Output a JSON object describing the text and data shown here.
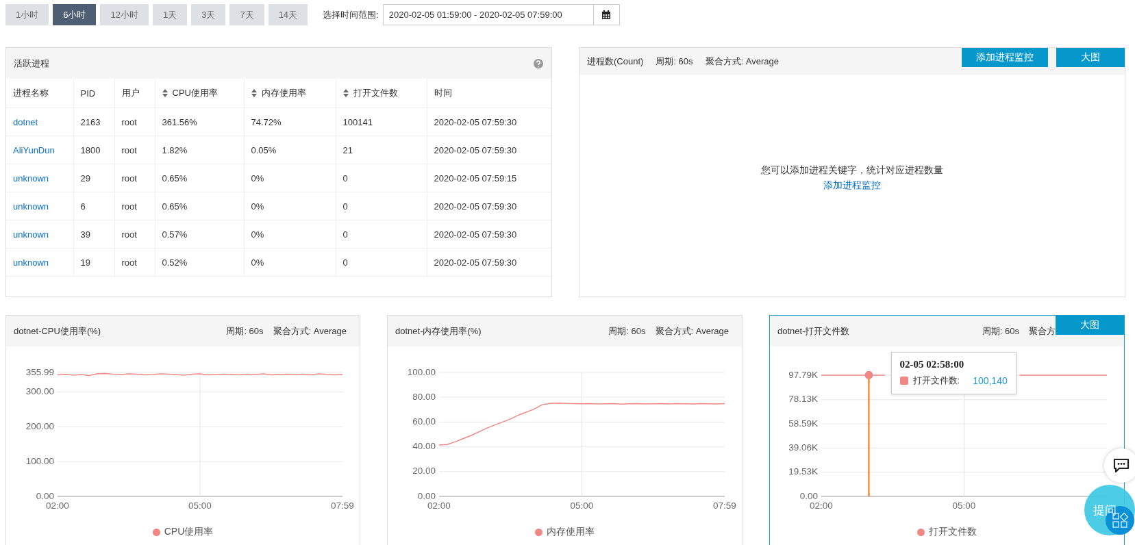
{
  "time_range": {
    "options": [
      {
        "label": "1小时",
        "selected": false
      },
      {
        "label": "6小时",
        "selected": true
      },
      {
        "label": "12小时",
        "selected": false
      },
      {
        "label": "1天",
        "selected": false
      },
      {
        "label": "3天",
        "selected": false
      },
      {
        "label": "7天",
        "selected": false
      },
      {
        "label": "14天",
        "selected": false
      }
    ],
    "label": "选择时间范围:",
    "value": "2020-02-05 01:59:00 - 2020-02-05 07:59:00"
  },
  "process_table": {
    "title": "活跃进程",
    "columns": [
      {
        "label": "进程名称",
        "kind": "link",
        "sortable": false
      },
      {
        "label": "PID",
        "kind": "text",
        "sortable": false
      },
      {
        "label": "用户",
        "kind": "text",
        "sortable": false
      },
      {
        "label": "CPU使用率",
        "kind": "text",
        "sortable": true
      },
      {
        "label": "内存使用率",
        "kind": "text",
        "sortable": true
      },
      {
        "label": "打开文件数",
        "kind": "text",
        "sortable": true
      },
      {
        "label": "时间",
        "kind": "text",
        "sortable": false
      }
    ],
    "rows": [
      [
        "dotnet",
        "2163",
        "root",
        "361.56%",
        "74.72%",
        "100141",
        "2020-02-05 07:59:30"
      ],
      [
        "AliYunDun",
        "1800",
        "root",
        "1.82%",
        "0.05%",
        "21",
        "2020-02-05 07:59:30"
      ],
      [
        "unknown",
        "29",
        "root",
        "0.65%",
        "0%",
        "0",
        "2020-02-05 07:59:15"
      ],
      [
        "unknown",
        "6",
        "root",
        "0.65%",
        "0%",
        "0",
        "2020-02-05 07:59:30"
      ],
      [
        "unknown",
        "39",
        "root",
        "0.57%",
        "0%",
        "0",
        "2020-02-05 07:59:30"
      ],
      [
        "unknown",
        "19",
        "root",
        "0.52%",
        "0%",
        "0",
        "2020-02-05 07:59:30"
      ]
    ]
  },
  "count_panel": {
    "title": "进程数(Count)",
    "period": "周期: 60s",
    "aggregation": "聚合方式: Average",
    "buttons": [
      "添加进程监控",
      "大图"
    ],
    "empty_message": "您可以添加进程关键字，统计对应进程数量",
    "empty_link": "添加进程监控"
  },
  "charts": [
    {
      "title": "dotnet-CPU使用率(%)",
      "period": "周期: 60s",
      "aggregation": "聚合方式: Average",
      "highlighted": false,
      "chart_data": {
        "type": "line",
        "categories": [
          "02:00",
          null,
          null,
          null,
          null,
          null,
          null,
          null,
          null,
          null,
          null,
          null,
          null,
          null,
          null,
          null,
          null,
          null,
          "05:00",
          null,
          null,
          null,
          null,
          null,
          null,
          null,
          null,
          null,
          null,
          null,
          null,
          null,
          null,
          null,
          null,
          null,
          "07:59"
        ],
        "grid": true,
        "series": [
          {
            "name": "CPU使用率",
            "color": "#f08784",
            "values": [
              349,
              351,
              348,
              350,
              347,
              352,
              353,
              351,
              350,
              352,
              351,
              349,
              350,
              352,
              351,
              350,
              348,
              351,
              352,
              349,
              350,
              351,
              350,
              349,
              351,
              350,
              352,
              349,
              350,
              351,
              350,
              351,
              349,
              352,
              350,
              349,
              350
            ]
          }
        ],
        "ylim": [
          0,
          355.99
        ],
        "yticks": [
          {
            "value": 0,
            "label": "0.00"
          },
          {
            "value": 100,
            "label": "100.00"
          },
          {
            "value": 200,
            "label": "200.00"
          },
          {
            "value": 300,
            "label": "300.00"
          },
          {
            "value": 355.99,
            "label": "355.99"
          }
        ]
      }
    },
    {
      "title": "dotnet-内存使用率(%)",
      "period": "周期: 60s",
      "aggregation": "聚合方式: Average",
      "highlighted": false,
      "chart_data": {
        "type": "line",
        "categories": [
          "02:00",
          null,
          null,
          null,
          null,
          null,
          null,
          null,
          null,
          null,
          null,
          null,
          null,
          null,
          null,
          null,
          null,
          null,
          "05:00",
          null,
          null,
          null,
          null,
          null,
          null,
          null,
          null,
          null,
          null,
          null,
          null,
          null,
          null,
          null,
          null,
          null,
          "07:59"
        ],
        "grid": true,
        "series": [
          {
            "name": "内存使用率",
            "color": "#f08784",
            "values": [
              41.5,
              41.8,
              44,
              46.5,
              49,
              52,
              55,
              57.5,
              60,
              62.5,
              65.5,
              68,
              70.5,
              74,
              75,
              75.3,
              75,
              74.8,
              74.7,
              74.8,
              74.6,
              74.7,
              74.9,
              74.5,
              74.7,
              74.9,
              74.6,
              74.7,
              74.8,
              74.6,
              74.9,
              74.7,
              74.6,
              74.8,
              74.7,
              74.6,
              74.8
            ]
          }
        ],
        "ylim": [
          0,
          100
        ],
        "yticks": [
          {
            "value": 0,
            "label": "0.00"
          },
          {
            "value": 20,
            "label": "20.00"
          },
          {
            "value": 40,
            "label": "40.00"
          },
          {
            "value": 60,
            "label": "60.00"
          },
          {
            "value": 80,
            "label": "80.00"
          },
          {
            "value": 100,
            "label": "100.00"
          }
        ]
      }
    },
    {
      "title": "dotnet-打开文件数",
      "period": "周期: 60s",
      "aggregation": "聚合方",
      "highlighted": true,
      "big_button": "大图",
      "tooltip": {
        "title": "02-05 02:58:00",
        "label": "打开文件数:",
        "value": "100,140"
      },
      "chart_data": {
        "type": "line",
        "categories": [
          "02:00",
          null,
          null,
          null,
          null,
          null,
          null,
          null,
          null,
          null,
          null,
          null,
          null,
          null,
          null,
          null,
          null,
          null,
          "05:00",
          null,
          null,
          null,
          null,
          null,
          null,
          null,
          null,
          null,
          null,
          null,
          null,
          null,
          null,
          null,
          null,
          null,
          null
        ],
        "series": [
          {
            "name": "打开文件数",
            "color": "#f08784",
            "values": [
              98000,
              98000,
              98000,
              98000,
              98000,
              98000,
              98000,
              98000,
              98000,
              null,
              null,
              null,
              null,
              null,
              null,
              null,
              null,
              null,
              null,
              null,
              null,
              null,
              null,
              null,
              null,
              98000,
              98000,
              98000,
              98000,
              98000,
              98000,
              98000,
              98000,
              98000,
              98000,
              98000,
              98000
            ]
          }
        ],
        "grid": true,
        "ylim": [
          0,
          100140
        ],
        "yticks": [
          {
            "value": 0,
            "label": "0.00"
          },
          {
            "value": 19530,
            "label": "19.53K"
          },
          {
            "value": 39060,
            "label": "39.06K"
          },
          {
            "value": 58590,
            "label": "58.59K"
          },
          {
            "value": 78130,
            "label": "78.13K"
          },
          {
            "value": 97790,
            "label": "97.79K"
          }
        ]
      }
    }
  ],
  "help_widget": {
    "ask_label": "提问"
  }
}
